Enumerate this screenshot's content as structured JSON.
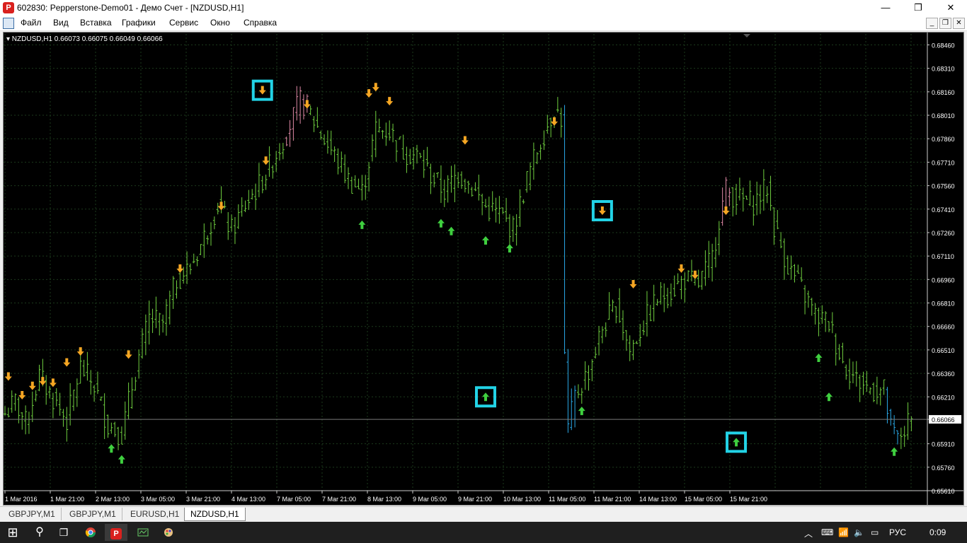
{
  "window": {
    "title": "602830: Pepperstone-Demo01 - Демо Счет - [NZDUSD,H1]",
    "app_icon_letter": "P",
    "minimize": "—",
    "maximize": "❐",
    "close": "✕"
  },
  "menu": {
    "items": [
      "Файл",
      "Вид",
      "Вставка",
      "Графики",
      "Сервис",
      "Окно",
      "Справка"
    ],
    "mdi_minimize": "_",
    "mdi_restore": "❐",
    "mdi_close": "✕"
  },
  "chart": {
    "symbol_info": "▾ NZDUSD,H1  0.66073 0.66075 0.66049 0.66066",
    "price_labels": [
      "0.68460",
      "0.68310",
      "0.68160",
      "0.68010",
      "0.67860",
      "0.67710",
      "0.67560",
      "0.67410",
      "0.67260",
      "0.67110",
      "0.66960",
      "0.66810",
      "0.66660",
      "0.66510",
      "0.66360",
      "0.66210",
      "0.66066",
      "0.65910",
      "0.65760",
      "0.65610"
    ],
    "current_price": "0.66066",
    "time_labels": [
      "1 Mar 2016",
      "1 Mar 21:00",
      "2 Mar 13:00",
      "3 Mar 05:00",
      "3 Mar 21:00",
      "4 Mar 13:00",
      "7 Mar 05:00",
      "7 Mar 21:00",
      "8 Mar 13:00",
      "9 Mar 05:00",
      "9 Mar 21:00",
      "10 Mar 13:00",
      "11 Mar 05:00",
      "11 Mar 21:00",
      "14 Mar 13:00",
      "15 Mar 05:00",
      "15 Mar 21:00"
    ],
    "colors": {
      "background": "#000000",
      "grid": "#1c3a1c",
      "bar_normal": "#6fcf3f",
      "bar_high": "#e08aa6",
      "bar_low": "#2aa9e8",
      "arrow_down": "#f5a623",
      "arrow_up": "#3fcf3f",
      "highlight_box": "#22d3e6",
      "text": "#ffffff"
    }
  },
  "chart_data": {
    "type": "ohlc",
    "symbol": "NZDUSD",
    "timeframe": "H1",
    "ylim": [
      0.6561,
      0.6853
    ],
    "close_points": [
      [
        0,
        0.661
      ],
      [
        3,
        0.6618
      ],
      [
        6,
        0.6604
      ],
      [
        10,
        0.6634
      ],
      [
        14,
        0.662
      ],
      [
        18,
        0.6606
      ],
      [
        22,
        0.664
      ],
      [
        26,
        0.6628
      ],
      [
        30,
        0.6603
      ],
      [
        34,
        0.6597
      ],
      [
        38,
        0.6638
      ],
      [
        42,
        0.6671
      ],
      [
        46,
        0.6668
      ],
      [
        50,
        0.6696
      ],
      [
        54,
        0.6704
      ],
      [
        58,
        0.6723
      ],
      [
        62,
        0.6744
      ],
      [
        66,
        0.6727
      ],
      [
        70,
        0.6744
      ],
      [
        74,
        0.6756
      ],
      [
        78,
        0.6772
      ],
      [
        82,
        0.679
      ],
      [
        86,
        0.681
      ],
      [
        88,
        0.6806
      ],
      [
        92,
        0.6789
      ],
      [
        96,
        0.6775
      ],
      [
        100,
        0.676
      ],
      [
        104,
        0.6752
      ],
      [
        108,
        0.6792
      ],
      [
        112,
        0.6791
      ],
      [
        116,
        0.6778
      ],
      [
        120,
        0.6775
      ],
      [
        124,
        0.6763
      ],
      [
        128,
        0.6752
      ],
      [
        132,
        0.6764
      ],
      [
        136,
        0.6755
      ],
      [
        140,
        0.6742
      ],
      [
        144,
        0.6738
      ],
      [
        148,
        0.6728
      ],
      [
        152,
        0.676
      ],
      [
        156,
        0.6785
      ],
      [
        160,
        0.6805
      ],
      [
        162,
        0.6799
      ],
      [
        163,
        0.6645
      ],
      [
        164,
        0.66
      ],
      [
        166,
        0.6621
      ],
      [
        170,
        0.6638
      ],
      [
        174,
        0.6665
      ],
      [
        178,
        0.668
      ],
      [
        182,
        0.665
      ],
      [
        186,
        0.6668
      ],
      [
        190,
        0.6684
      ],
      [
        194,
        0.6689
      ],
      [
        198,
        0.6696
      ],
      [
        202,
        0.6693
      ],
      [
        206,
        0.671
      ],
      [
        208,
        0.6735
      ],
      [
        210,
        0.6753
      ],
      [
        214,
        0.6747
      ],
      [
        218,
        0.6745
      ],
      [
        222,
        0.6755
      ],
      [
        224,
        0.673
      ],
      [
        228,
        0.6705
      ],
      [
        232,
        0.669
      ],
      [
        236,
        0.6673
      ],
      [
        240,
        0.6668
      ],
      [
        244,
        0.6643
      ],
      [
        248,
        0.6632
      ],
      [
        252,
        0.6626
      ],
      [
        256,
        0.6625
      ],
      [
        258,
        0.66
      ],
      [
        260,
        0.6594
      ],
      [
        262,
        0.66
      ],
      [
        264,
        0.6607
      ]
    ],
    "signals": [
      {
        "dir": "down",
        "i": 1,
        "p": 0.6634
      },
      {
        "dir": "down",
        "i": 5,
        "p": 0.6622
      },
      {
        "dir": "down",
        "i": 8,
        "p": 0.6628
      },
      {
        "dir": "down",
        "i": 11,
        "p": 0.6631
      },
      {
        "dir": "down",
        "i": 14,
        "p": 0.663
      },
      {
        "dir": "down",
        "i": 18,
        "p": 0.6643
      },
      {
        "dir": "down",
        "i": 22,
        "p": 0.665
      },
      {
        "dir": "up",
        "i": 31,
        "p": 0.6588
      },
      {
        "dir": "up",
        "i": 34,
        "p": 0.6581
      },
      {
        "dir": "down",
        "i": 36,
        "p": 0.6648
      },
      {
        "dir": "down",
        "i": 51,
        "p": 0.6703
      },
      {
        "dir": "down",
        "i": 63,
        "p": 0.6743
      },
      {
        "dir": "down",
        "i": 76,
        "p": 0.6772
      },
      {
        "dir": "down",
        "i": 88,
        "p": 0.6808
      },
      {
        "dir": "up",
        "i": 104,
        "p": 0.6731
      },
      {
        "dir": "down",
        "i": 106,
        "p": 0.6815
      },
      {
        "dir": "down",
        "i": 108,
        "p": 0.6819
      },
      {
        "dir": "down",
        "i": 112,
        "p": 0.681
      },
      {
        "dir": "up",
        "i": 127,
        "p": 0.6732
      },
      {
        "dir": "up",
        "i": 130,
        "p": 0.6727
      },
      {
        "dir": "down",
        "i": 134,
        "p": 0.6785
      },
      {
        "dir": "up",
        "i": 140,
        "p": 0.6721
      },
      {
        "dir": "up",
        "i": 147,
        "p": 0.6716
      },
      {
        "dir": "down",
        "i": 160,
        "p": 0.6797
      },
      {
        "dir": "up",
        "i": 168,
        "p": 0.6612
      },
      {
        "dir": "down",
        "i": 183,
        "p": 0.6693
      },
      {
        "dir": "down",
        "i": 197,
        "p": 0.6703
      },
      {
        "dir": "down",
        "i": 201,
        "p": 0.6699
      },
      {
        "dir": "down",
        "i": 210,
        "p": 0.674
      },
      {
        "dir": "up",
        "i": 237,
        "p": 0.6646
      },
      {
        "dir": "up",
        "i": 240,
        "p": 0.6621
      },
      {
        "dir": "up",
        "i": 259,
        "p": 0.6586
      }
    ],
    "highlight_signal_indexes": [
      89,
      165,
      209,
      260
    ]
  },
  "tabs": {
    "items": [
      "GBPJPY,M1",
      "GBPJPY,M1",
      "EURUSD,H1",
      "NZDUSD,H1"
    ],
    "active_index": 3
  },
  "taskbar": {
    "start_icon": "⊞",
    "search_icon": "⚲",
    "task_view_icon": "❐",
    "lang": "РУС",
    "time": "0:09"
  }
}
